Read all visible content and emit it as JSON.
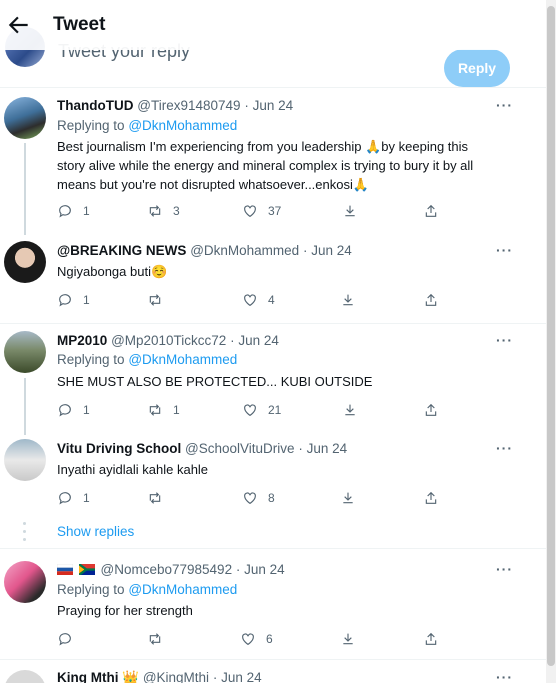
{
  "header": {
    "title": "Tweet"
  },
  "composer": {
    "placeholder": "Tweet your reply",
    "reply_label": "Reply"
  },
  "tweets": [
    {
      "name": "ThandoTUD",
      "handle": "@Tirex91480749",
      "date": "Jun 24",
      "replying_prefix": "Replying to",
      "replying_to": "@DknMohammed",
      "text": "Best journalism I'm experiencing from you leadership 🙏by keeping this story alive while the energy and mineral complex is trying to bury it by all means but you're not disrupted whatsoever...enkosi🙏",
      "replies": "1",
      "retweets": "3",
      "likes": "37"
    },
    {
      "name": "@BREAKING NEWS",
      "handle": "@DknMohammed",
      "date": "Jun 24",
      "text": "Ngiyabonga buti☺️",
      "replies": "1",
      "retweets": "",
      "likes": "4"
    },
    {
      "name": "MP2010",
      "handle": "@Mp2010Tickcc72",
      "date": "Jun 24",
      "replying_prefix": "Replying to",
      "replying_to": "@DknMohammed",
      "text": "SHE MUST ALSO BE PROTECTED... KUBI OUTSIDE",
      "replies": "1",
      "retweets": "1",
      "likes": "21"
    },
    {
      "name": "Vitu Driving School",
      "handle": "@SchoolVituDrive",
      "date": "Jun 24",
      "text": "Inyathi ayidlali kahle kahle",
      "replies": "1",
      "retweets": "",
      "likes": "8"
    },
    {
      "name": "",
      "handle": "@Nomcebo77985492",
      "date": "Jun 24",
      "replying_prefix": "Replying to",
      "replying_to": "@DknMohammed",
      "text": "Praying for her strength",
      "replies": "",
      "retweets": "",
      "likes": "6"
    },
    {
      "name": "King Mthi 👑",
      "handle": "@KingMthi",
      "date": "Jun 24"
    }
  ],
  "thread": {
    "show_replies": "Show replies"
  },
  "separator": "·",
  "more_label": "···",
  "colors": {
    "accent": "#1d9bf0",
    "muted": "#536471",
    "reply_button": "#8ecdf8"
  }
}
